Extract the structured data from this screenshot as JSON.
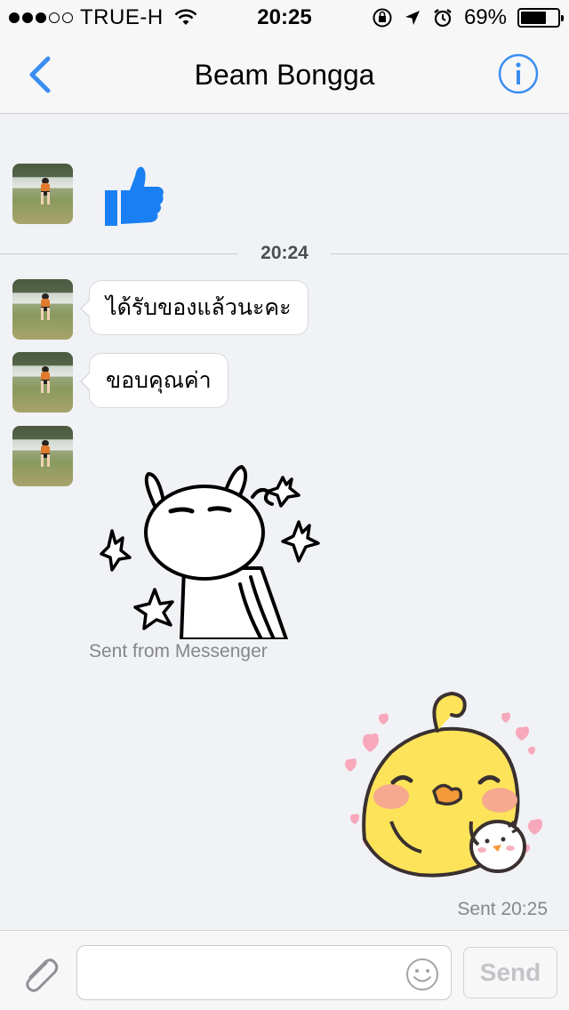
{
  "status_bar": {
    "carrier": "TRUE-H",
    "time": "20:25",
    "battery": "69%",
    "battery_level": 0.69,
    "signal_bars_filled": 3,
    "signal_bars_total": 5
  },
  "nav": {
    "title": "Beam Bongga",
    "back_icon": "chevron-left-icon",
    "info_icon": "info-icon",
    "accent_color": "#3b8df0"
  },
  "chat": {
    "messages": [
      {
        "sender": "contact",
        "type": "like",
        "icon": "thumbs-up-icon",
        "color": "#1a7ff3"
      },
      {
        "sender": "contact",
        "type": "text",
        "text": "ได้รับของแล้วนะคะ"
      },
      {
        "sender": "contact",
        "type": "text",
        "text": "ขอบคุณค่า"
      },
      {
        "sender": "contact",
        "type": "sticker",
        "sticker": "rabbit-sticker",
        "caption": "Sent from Messenger"
      },
      {
        "sender": "me",
        "type": "sticker",
        "sticker": "chick-sticker",
        "status": "Sent 20:25"
      }
    ],
    "time_divider": "20:24"
  },
  "composer": {
    "input_value": "",
    "input_placeholder": "",
    "send_label": "Send",
    "attach_icon": "paperclip-icon",
    "emoji_icon": "smiley-icon"
  }
}
